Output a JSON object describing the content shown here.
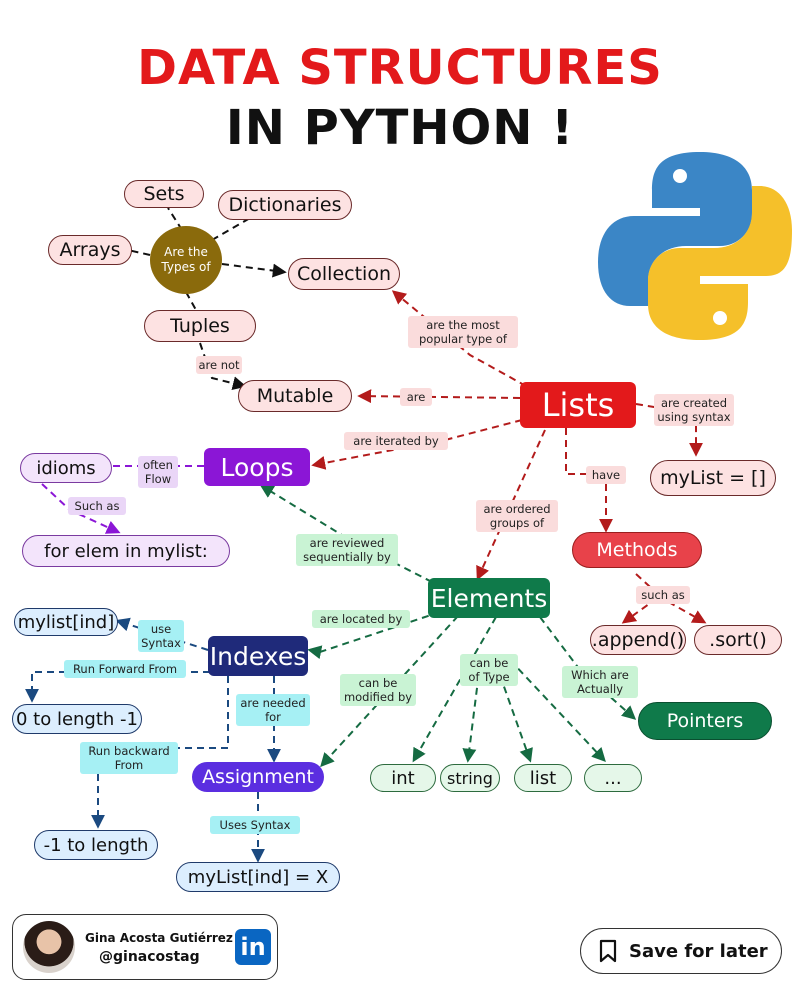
{
  "title": {
    "line1": "DATA STRUCTURES",
    "line2": "IN PYTHON !"
  },
  "nodes": {
    "sets": "Sets",
    "dictionaries": "Dictionaries",
    "arrays": "Arrays",
    "types_hub": "Are the Types of",
    "collection": "Collection",
    "tuples": "Tuples",
    "mutable": "Mutable",
    "lists": "Lists",
    "mylist_init": "myList = []",
    "loops": "Loops",
    "idioms": "idioms",
    "for_elem": "for elem in mylist:",
    "methods": "Methods",
    "append": ".append()",
    "sort": ".sort()",
    "elements": "Elements",
    "mylist_ind": "mylist[ind]",
    "indexes": "Indexes",
    "zero_to_len": "0 to length -1",
    "pointers": "Pointers",
    "assignment": "Assignment",
    "int": "int",
    "string": "string",
    "list": "list",
    "ellipsis": "...",
    "neg_one_to_len": "-1 to length",
    "mylist_assign": "myList[ind] = X"
  },
  "labels": {
    "most_popular": "are the most\npopular type of",
    "are_not": "are not",
    "are": "are",
    "created_using": "are created\nusing syntax",
    "iterated_by": "are iterated by",
    "have": "have",
    "often_flow": "often\nFlow",
    "such_as_loops": "Such as",
    "ordered_groups": "are ordered\ngroups of",
    "reviewed_seq": "are reviewed\nsequentially by",
    "such_as_methods": "such as",
    "located_by": "are located by",
    "use_syntax": "use\nSyntax",
    "run_forward": "Run Forward From",
    "needed_for": "are needed\nfor",
    "modified_by": "can be\nmodified by",
    "of_type": "can be\nof Type",
    "actually": "Which are\nActually",
    "run_backward": "Run backward\nFrom",
    "uses_syntax": "Uses Syntax"
  },
  "footer": {
    "author_name": "Gina Acosta Gutiérrez",
    "author_handle": "@ginacostag",
    "linkedin": "in",
    "save_label": "Save for later"
  },
  "icons": {
    "logo": "python-logo-icon",
    "social": "linkedin-icon",
    "bookmark": "bookmark-icon"
  },
  "colors": {
    "red": "#e3191b",
    "purple": "#8b16d6",
    "green": "#0f7a4a",
    "navy": "#1f2a7a",
    "python_blue": "#3b86c6",
    "python_yellow": "#f5c02a"
  }
}
